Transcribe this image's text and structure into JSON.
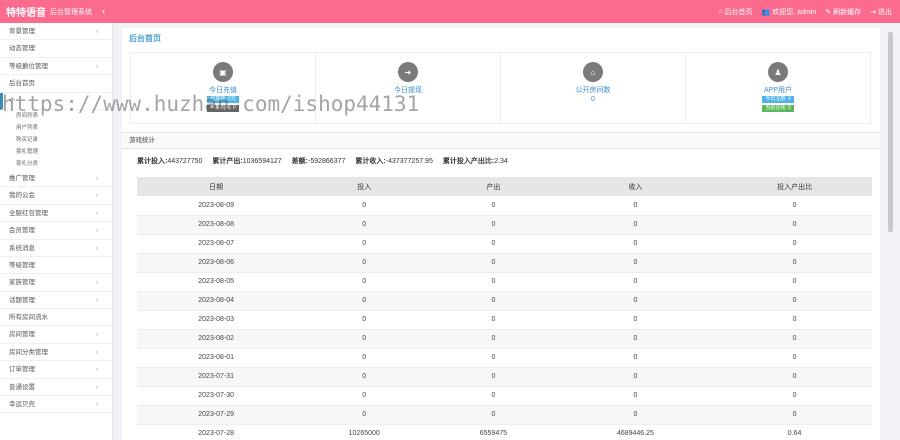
{
  "header": {
    "brand": "特特语音",
    "brand_sub": "后台管理系统",
    "nav": [
      {
        "icon": "home-icon",
        "glyph": "⌂",
        "label": "后台首页"
      },
      {
        "icon": "users-icon",
        "glyph": "👥",
        "label": "欢迎您, admin"
      },
      {
        "icon": "refresh-icon",
        "glyph": "✎",
        "label": "刷新缓存"
      },
      {
        "icon": "logout-icon",
        "glyph": "⇥",
        "label": "退出"
      }
    ]
  },
  "sidebar": {
    "items": [
      {
        "label": "背景管理",
        "arrow": "›"
      },
      {
        "label": "动态管理",
        "arrow": ""
      },
      {
        "label": "等级爵位管理",
        "arrow": "›"
      },
      {
        "label": "后台首页",
        "arrow": ""
      },
      {
        "label": "个",
        "arrow": "",
        "active": true
      },
      {
        "label": "",
        "sub": [
          "房间列表",
          "用户列表",
          "购买记录",
          "豪礼管理",
          "豪礼分类"
        ]
      },
      {
        "label": "推广管理",
        "arrow": "›"
      },
      {
        "label": "我的公会",
        "arrow": "›"
      },
      {
        "label": "全服红包管理",
        "arrow": "›"
      },
      {
        "label": "会员管理",
        "arrow": "›"
      },
      {
        "label": "系统消息",
        "arrow": "›"
      },
      {
        "label": "等级管理",
        "arrow": ""
      },
      {
        "label": "家族管理",
        "arrow": "›"
      },
      {
        "label": "话题管理",
        "arrow": "›"
      },
      {
        "label": "所有房间流水",
        "arrow": ""
      },
      {
        "label": "房间管理",
        "arrow": "›"
      },
      {
        "label": "房间分类管理",
        "arrow": "›"
      },
      {
        "label": "订单管理",
        "arrow": "›"
      },
      {
        "label": "普通设置",
        "arrow": "›"
      },
      {
        "label": "幸运贝壳",
        "arrow": "›"
      }
    ]
  },
  "page_title": "后台首页",
  "cards": [
    {
      "icon": "money-icon",
      "glyph": "▣",
      "label": "今日充值",
      "badges": [
        {
          "text": "代理商: 0元",
          "color": "blue"
        },
        {
          "text": "苹果内购: 0",
          "color": "dark"
        }
      ]
    },
    {
      "icon": "withdraw-icon",
      "glyph": "➜",
      "label": "今日提现",
      "badges": []
    },
    {
      "icon": "house-icon",
      "glyph": "⌂",
      "label": "公开房间数",
      "value": "0",
      "badges": []
    },
    {
      "icon": "user-icon",
      "glyph": "♟",
      "label": "APP用户",
      "badges": [
        {
          "text": "今日注册: 0",
          "color": "blue"
        },
        {
          "text": "当前在线: 0",
          "color": "green"
        }
      ]
    }
  ],
  "section_title": "游戏统计",
  "summary": [
    {
      "label": "累计投入:",
      "value": "443727750"
    },
    {
      "label": "累计产出:",
      "value": "1036594127"
    },
    {
      "label": "差额:",
      "value": "-592866377"
    },
    {
      "label": "累计收入:",
      "value": "-437377257.95"
    },
    {
      "label": "累计投入产出比:",
      "value": "2.34"
    }
  ],
  "table": {
    "columns": [
      "日期",
      "投入",
      "产出",
      "收入",
      "投入产出比"
    ],
    "rows": [
      [
        "2023-08-09",
        "0",
        "0",
        "0",
        "0"
      ],
      [
        "2023-08-08",
        "0",
        "0",
        "0",
        "0"
      ],
      [
        "2023-08-07",
        "0",
        "0",
        "0",
        "0"
      ],
      [
        "2023-08-06",
        "0",
        "0",
        "0",
        "0"
      ],
      [
        "2023-08-05",
        "0",
        "0",
        "0",
        "0"
      ],
      [
        "2023-08-04",
        "0",
        "0",
        "0",
        "0"
      ],
      [
        "2023-08-03",
        "0",
        "0",
        "0",
        "0"
      ],
      [
        "2023-08-02",
        "0",
        "0",
        "0",
        "0"
      ],
      [
        "2023-08-01",
        "0",
        "0",
        "0",
        "0"
      ],
      [
        "2023-07-31",
        "0",
        "0",
        "0",
        "0"
      ],
      [
        "2023-07-30",
        "0",
        "0",
        "0",
        "0"
      ],
      [
        "2023-07-29",
        "0",
        "0",
        "0",
        "0"
      ],
      [
        "2023-07-28",
        "10265000",
        "6559475",
        "4689446.25",
        "0.64"
      ]
    ]
  },
  "watermark": "https://www.huzhan.com/ishop44131",
  "colors": {
    "header": "#fb6b8e",
    "accent": "#4a9fd4"
  }
}
